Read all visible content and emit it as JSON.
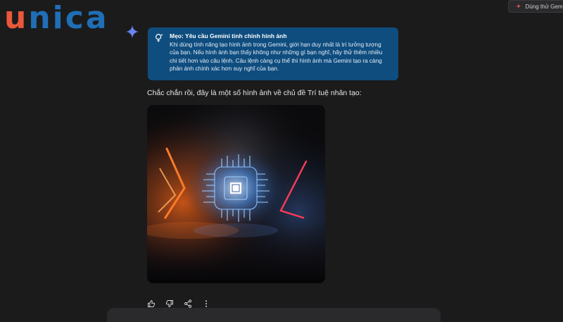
{
  "brand": {
    "logo_text": "unica",
    "logo_first": "u",
    "logo_rest": "nica",
    "accent_orange": "#e8583a",
    "accent_blue": "#1f6fb6"
  },
  "top_bar": {
    "button_label": "Dùng thử Gemini"
  },
  "tip": {
    "title": "Mẹo: Yêu cầu Gemini tinh chỉnh hình ảnh",
    "body": "Khi dùng tính năng tạo hình ảnh trong Gemini, giới hạn duy nhất là trí tưởng tượng của bạn. Nếu hình ảnh bạn thấy không như những gì bạn nghĩ, hãy thử thêm nhiều chi tiết hơn vào câu lệnh. Câu lệnh càng cụ thể thì hình ảnh mà Gemini tạo ra càng phản ánh chính xác hơn suy nghĩ của bạn.",
    "background": "#0f4d7f"
  },
  "response": {
    "text": "Chắc chắn rồi, đây là một số hình ảnh về chủ đề Trí tuệ nhân tạo:",
    "image_subject": "ai-chip-neon"
  },
  "actions": [
    "thumbs-up-icon",
    "thumbs-down-icon",
    "share-icon",
    "more-vert-icon"
  ]
}
